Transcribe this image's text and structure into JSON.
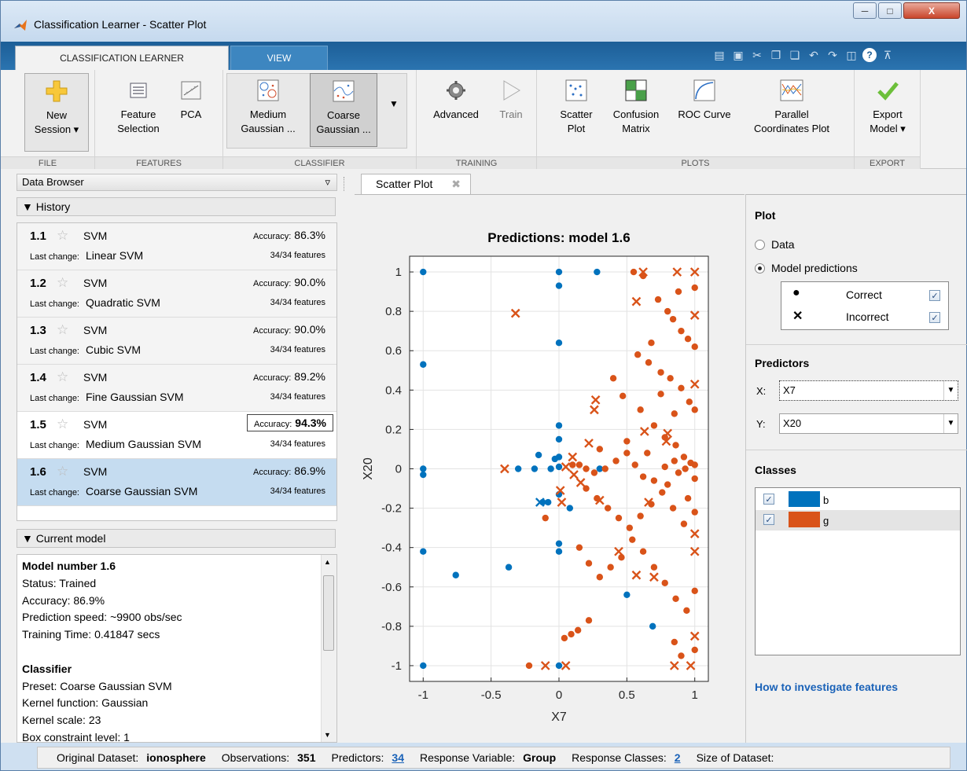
{
  "window": {
    "title": "Classification Learner - Scatter Plot"
  },
  "ribbon_tabs": [
    "CLASSIFICATION LEARNER",
    "VIEW"
  ],
  "ribbon": {
    "groups": [
      "FILE",
      "FEATURES",
      "CLASSIFIER",
      "TRAINING",
      "PLOTS",
      "EXPORT"
    ],
    "new_session": "New\nSession",
    "feature_selection": "Feature\nSelection",
    "pca": "PCA",
    "medium_gaussian": "Medium\nGaussian ...",
    "coarse_gaussian": "Coarse\nGaussian ...",
    "advanced": "Advanced",
    "train": "Train",
    "scatter_plot": "Scatter\nPlot",
    "confusion_matrix": "Confusion\nMatrix",
    "roc_curve": "ROC Curve",
    "parallel_coords": "Parallel\nCoordinates Plot",
    "export_model": "Export\nModel"
  },
  "data_browser": {
    "title": "Data Browser",
    "history_label": "History",
    "history": [
      {
        "num": "1.1",
        "model": "SVM",
        "acc_label": "Accuracy:",
        "acc": "86.3%",
        "lc_label": "Last change:",
        "change": "Linear SVM",
        "features": "34/34 features"
      },
      {
        "num": "1.2",
        "model": "SVM",
        "acc_label": "Accuracy:",
        "acc": "90.0%",
        "lc_label": "Last change:",
        "change": "Quadratic SVM",
        "features": "34/34 features"
      },
      {
        "num": "1.3",
        "model": "SVM",
        "acc_label": "Accuracy:",
        "acc": "90.0%",
        "lc_label": "Last change:",
        "change": "Cubic SVM",
        "features": "34/34 features"
      },
      {
        "num": "1.4",
        "model": "SVM",
        "acc_label": "Accuracy:",
        "acc": "89.2%",
        "lc_label": "Last change:",
        "change": "Fine Gaussian SVM",
        "features": "34/34 features"
      },
      {
        "num": "1.5",
        "model": "SVM",
        "acc_label": "Accuracy:",
        "acc": "94.3%",
        "lc_label": "Last change:",
        "change": "Medium Gaussian SVM",
        "features": "34/34 features"
      },
      {
        "num": "1.6",
        "model": "SVM",
        "acc_label": "Accuracy:",
        "acc": "86.9%",
        "lc_label": "Last change:",
        "change": "Coarse Gaussian SVM",
        "features": "34/34 features"
      }
    ],
    "current_model_label": "Current model",
    "current_model": {
      "model_number": "Model number 1.6",
      "status": "Status: Trained",
      "accuracy": "Accuracy: 86.9%",
      "pred_speed": "Prediction speed: ~9900 obs/sec",
      "train_time": "Training Time: 0.41847 secs",
      "classifier_heading": "Classifier",
      "preset": "Preset: Coarse Gaussian SVM",
      "kernel_fn": "Kernel function: Gaussian",
      "kernel_scale": "Kernel scale: 23",
      "box_constraint": "Box constraint level: 1"
    }
  },
  "doc_tab": {
    "label": "Scatter Plot"
  },
  "plot_panel": {
    "heading": "Plot",
    "data_radio": "Data",
    "model_pred_radio": "Model predictions",
    "correct": "Correct",
    "incorrect": "Incorrect",
    "predictors_heading": "Predictors",
    "x_label": "X:",
    "x_value": "X7",
    "y_label": "Y:",
    "y_value": "X20",
    "classes_heading": "Classes",
    "classes": [
      {
        "name": "b",
        "color": "#0072bd"
      },
      {
        "name": "g",
        "color": "#d95319"
      }
    ],
    "link": "How to investigate features"
  },
  "status_bar": {
    "orig_label": "Original Dataset:",
    "orig_value": "ionosphere",
    "obs_label": "Observations:",
    "obs_value": "351",
    "pred_label": "Predictors:",
    "pred_value": "34",
    "resp_label": "Response Variable:",
    "resp_value": "Group",
    "rc_label": "Response Classes:",
    "rc_value": "2",
    "size_label": "Size of Dataset:"
  },
  "chart_data": {
    "type": "scatter",
    "title": "Predictions: model 1.6",
    "xlabel": "X7",
    "ylabel": "X20",
    "xlim": [
      -1.1,
      1.1
    ],
    "ylim": [
      -1.08,
      1.08
    ],
    "xticks": [
      -1,
      -0.5,
      0,
      0.5,
      1
    ],
    "yticks": [
      1,
      0.8,
      0.6,
      0.4,
      0.2,
      0,
      -0.2,
      -0.4,
      -0.6,
      -0.8,
      -1
    ],
    "xtick_labels": [
      "-1",
      "-0.5",
      "0",
      "0.5",
      "1"
    ],
    "ytick_labels": [
      "1",
      "0.8",
      "0.6",
      "0.4",
      "0.2",
      "0",
      "-0.2",
      "-0.4",
      "-0.6",
      "-0.8",
      "-1"
    ],
    "grid": true,
    "series": [
      {
        "name": "b",
        "marker": "correct",
        "color": "#0072bd",
        "points": [
          [
            -1,
            1
          ],
          [
            -1,
            0.53
          ],
          [
            -1,
            0
          ],
          [
            -1,
            -0.03
          ],
          [
            -1,
            -0.42
          ],
          [
            -1,
            -1
          ],
          [
            -0.76,
            -0.54
          ],
          [
            -0.37,
            -0.5
          ],
          [
            0,
            1
          ],
          [
            0,
            0.93
          ],
          [
            0,
            0.64
          ],
          [
            0,
            0.22
          ],
          [
            0,
            0.15
          ],
          [
            0,
            0.06
          ],
          [
            0,
            0.01
          ],
          [
            -0.03,
            0.05
          ],
          [
            -0.3,
            0
          ],
          [
            -0.18,
            0
          ],
          [
            -0.15,
            0.07
          ],
          [
            -0.06,
            0
          ],
          [
            0,
            -0.13
          ],
          [
            -0.08,
            -0.17
          ],
          [
            0,
            -0.38
          ],
          [
            0,
            -0.42
          ],
          [
            0.08,
            -0.2
          ],
          [
            0.28,
            1
          ],
          [
            0.3,
            0
          ],
          [
            0.5,
            -0.64
          ],
          [
            0.69,
            -0.8
          ],
          [
            0,
            -1
          ],
          [
            -0.12,
            -0.17
          ]
        ]
      },
      {
        "name": "g",
        "marker": "correct",
        "color": "#d95319",
        "points": [
          [
            0.55,
            1
          ],
          [
            0.62,
            0.98
          ],
          [
            0.73,
            0.86
          ],
          [
            0.84,
            0.76
          ],
          [
            0.9,
            0.7
          ],
          [
            0.95,
            0.66
          ],
          [
            1,
            0.62
          ],
          [
            0.58,
            0.58
          ],
          [
            0.66,
            0.54
          ],
          [
            0.75,
            0.49
          ],
          [
            0.82,
            0.46
          ],
          [
            0.9,
            0.41
          ],
          [
            0.96,
            0.34
          ],
          [
            1,
            0.3
          ],
          [
            0.4,
            0.46
          ],
          [
            0.47,
            0.37
          ],
          [
            0.6,
            0.3
          ],
          [
            0.7,
            0.22
          ],
          [
            0.78,
            0.16
          ],
          [
            0.86,
            0.12
          ],
          [
            0.92,
            0.06
          ],
          [
            1,
            0.02
          ],
          [
            0.15,
            0.02
          ],
          [
            0.2,
            0
          ],
          [
            0.26,
            -0.02
          ],
          [
            0.34,
            0
          ],
          [
            0.42,
            0.04
          ],
          [
            0.5,
            0.08
          ],
          [
            0.56,
            0.02
          ],
          [
            0.62,
            -0.04
          ],
          [
            0.7,
            -0.06
          ],
          [
            0.78,
            0.01
          ],
          [
            0.85,
            0.04
          ],
          [
            0.88,
            -0.02
          ],
          [
            0.93,
            0
          ],
          [
            0.97,
            0.03
          ],
          [
            1,
            -0.05
          ],
          [
            0.2,
            -0.1
          ],
          [
            0.28,
            -0.15
          ],
          [
            0.36,
            -0.2
          ],
          [
            0.44,
            -0.25
          ],
          [
            0.52,
            -0.3
          ],
          [
            0.6,
            -0.24
          ],
          [
            0.68,
            -0.18
          ],
          [
            0.76,
            -0.12
          ],
          [
            0.84,
            -0.2
          ],
          [
            0.92,
            -0.28
          ],
          [
            1,
            -0.22
          ],
          [
            0.15,
            -0.4
          ],
          [
            0.22,
            -0.48
          ],
          [
            0.3,
            -0.55
          ],
          [
            0.38,
            -0.5
          ],
          [
            0.46,
            -0.45
          ],
          [
            0.54,
            -0.36
          ],
          [
            0.62,
            -0.42
          ],
          [
            0.7,
            -0.5
          ],
          [
            0.78,
            -0.58
          ],
          [
            0.86,
            -0.66
          ],
          [
            0.94,
            -0.72
          ],
          [
            1,
            -0.62
          ],
          [
            0.04,
            -0.86
          ],
          [
            0.09,
            -0.84
          ],
          [
            0.14,
            -0.82
          ],
          [
            0.22,
            -0.77
          ],
          [
            -0.22,
            -1
          ],
          [
            -0.1,
            -0.25
          ],
          [
            0.85,
            -0.88
          ],
          [
            0.9,
            -0.95
          ],
          [
            1,
            -0.92
          ],
          [
            0.1,
            0.02
          ],
          [
            0.3,
            0.1
          ],
          [
            0.5,
            0.14
          ],
          [
            0.65,
            0.08
          ],
          [
            0.8,
            -0.08
          ],
          [
            0.95,
            -0.15
          ],
          [
            0.75,
            0.38
          ],
          [
            0.85,
            0.28
          ],
          [
            0.68,
            0.64
          ],
          [
            0.8,
            0.8
          ],
          [
            0.88,
            0.9
          ],
          [
            1,
            0.92
          ]
        ]
      },
      {
        "name": "b",
        "marker": "incorrect",
        "color": "#0072bd",
        "points": [
          [
            -0.14,
            -0.17
          ]
        ]
      },
      {
        "name": "g",
        "marker": "incorrect",
        "color": "#d95319",
        "points": [
          [
            -0.32,
            0.79
          ],
          [
            -0.4,
            0
          ],
          [
            0.26,
            0.3
          ],
          [
            0.27,
            0.35
          ],
          [
            0.62,
            1
          ],
          [
            0.57,
            0.85
          ],
          [
            1,
            1
          ],
          [
            0.87,
            1
          ],
          [
            1,
            0.78
          ],
          [
            1,
            0.43
          ],
          [
            0.63,
            0.19
          ],
          [
            0.79,
            0.14
          ],
          [
            0.8,
            0.18
          ],
          [
            0.1,
            0.06
          ],
          [
            0.05,
            0.01
          ],
          [
            0.22,
            0.13
          ],
          [
            0.01,
            -0.11
          ],
          [
            0.02,
            -0.17
          ],
          [
            0.11,
            -0.03
          ],
          [
            0.16,
            -0.07
          ],
          [
            0.44,
            -0.42
          ],
          [
            0.57,
            -0.54
          ],
          [
            0.66,
            -0.17
          ],
          [
            0.7,
            -0.55
          ],
          [
            1,
            -0.33
          ],
          [
            1,
            -0.42
          ],
          [
            1,
            -0.85
          ],
          [
            0.85,
            -1
          ],
          [
            0.97,
            -1
          ],
          [
            -0.1,
            -1
          ],
          [
            0.05,
            -1
          ],
          [
            0.3,
            -0.16
          ]
        ]
      }
    ]
  }
}
